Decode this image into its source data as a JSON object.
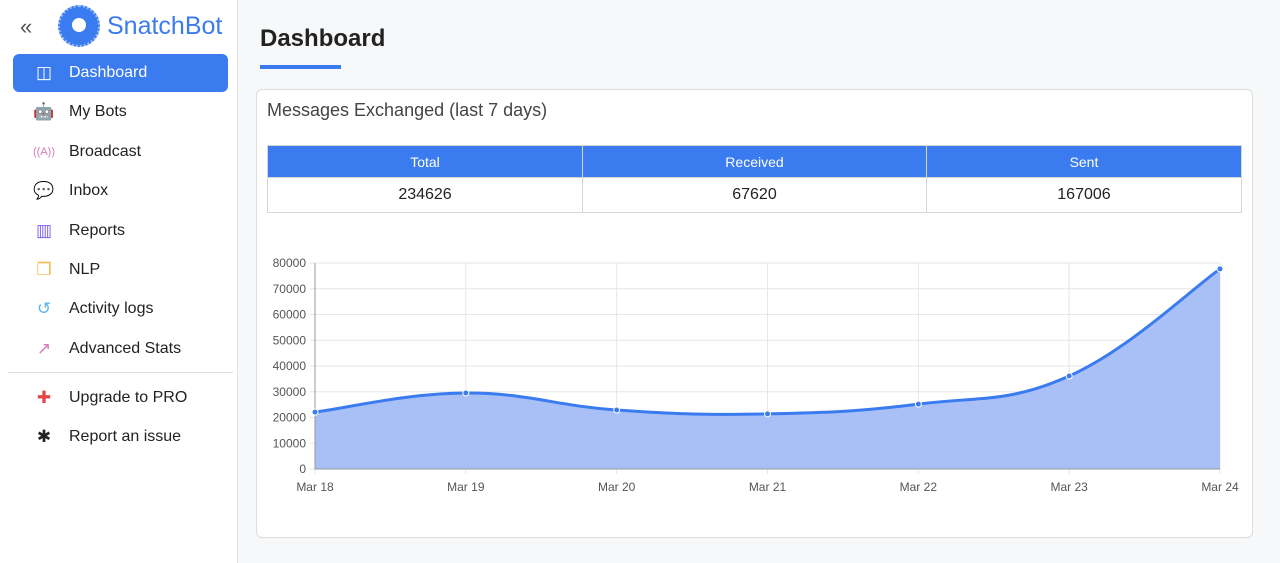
{
  "brand": {
    "name": "SnatchBot"
  },
  "sidebar": {
    "items": [
      {
        "label": "Dashboard",
        "icon": "dashboard-icon",
        "glyph": "◫",
        "color": "#ffffff",
        "active": true
      },
      {
        "label": "My Bots",
        "icon": "robot-icon",
        "glyph": "🤖",
        "color": "#5bb5f0"
      },
      {
        "label": "Broadcast",
        "icon": "broadcast-tower-icon",
        "glyph": "((A))",
        "color": "#d67ab8"
      },
      {
        "label": "Inbox",
        "icon": "chat-bubbles-icon",
        "glyph": "💬",
        "color": "#ef9a80"
      },
      {
        "label": "Reports",
        "icon": "bar-chart-icon",
        "glyph": "▥",
        "color": "#7b5cf0"
      },
      {
        "label": "NLP",
        "icon": "cubes-icon",
        "glyph": "❒",
        "color": "#f2b84b"
      },
      {
        "label": "Activity logs",
        "icon": "history-icon",
        "glyph": "↺",
        "color": "#5bb5f0"
      },
      {
        "label": "Advanced Stats",
        "icon": "line-chart-icon",
        "glyph": "↗",
        "color": "#d67ab8"
      }
    ],
    "bottom": [
      {
        "label": "Upgrade to PRO",
        "icon": "plus-badge-icon",
        "glyph": "✚",
        "color": "#e04848"
      },
      {
        "label": "Report an issue",
        "icon": "bug-icon",
        "glyph": "✱",
        "color": "#222222"
      }
    ]
  },
  "page": {
    "title": "Dashboard"
  },
  "card": {
    "title": "Messages Exchanged (last 7 days)",
    "headers": [
      "Total",
      "Received",
      "Sent"
    ],
    "values": [
      "234626",
      "67620",
      "167006"
    ]
  },
  "chart_data": {
    "type": "area",
    "categories": [
      "Mar 18",
      "Mar 19",
      "Mar 20",
      "Mar 21",
      "Mar 22",
      "Mar 23",
      "Mar 24"
    ],
    "values": [
      22100,
      29500,
      22900,
      21400,
      25200,
      36100,
      77700
    ],
    "ylim": [
      0,
      80000
    ],
    "yticks": [
      0,
      10000,
      20000,
      30000,
      40000,
      50000,
      60000,
      70000,
      80000
    ],
    "grid": true,
    "line_color": "#3b7bf0",
    "fill_color": "#a3bdf6"
  }
}
